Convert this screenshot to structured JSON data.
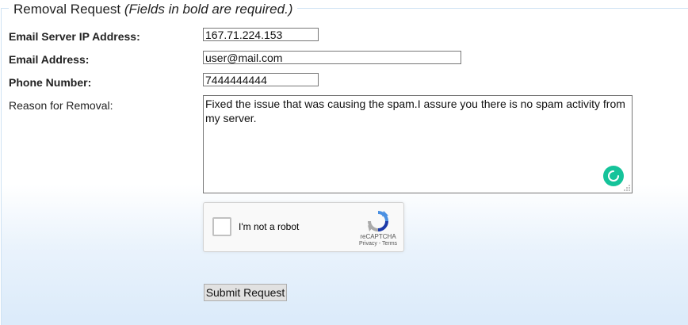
{
  "form": {
    "legend_title": "Removal Request",
    "legend_note": "(Fields in bold are required.)",
    "fields": {
      "ip": {
        "label": "Email Server IP Address:",
        "value": "167.71.224.153"
      },
      "email": {
        "label": "Email Address:",
        "value": "user@mail.com"
      },
      "phone": {
        "label": "Phone Number:",
        "value": "7444444444"
      },
      "reason": {
        "label": "Reason for Removal:",
        "value": "Fixed the issue that was causing the spam.I assure you there is no spam activity from my server."
      }
    },
    "captcha": {
      "label": "I'm not a robot",
      "brand": "reCAPTCHA",
      "links": "Privacy - Terms"
    },
    "submit_label": "Submit Request"
  },
  "colors": {
    "grammarly": "#15c39a",
    "border": "#cfe3f3",
    "gradient_bottom": "#dcebfa"
  }
}
